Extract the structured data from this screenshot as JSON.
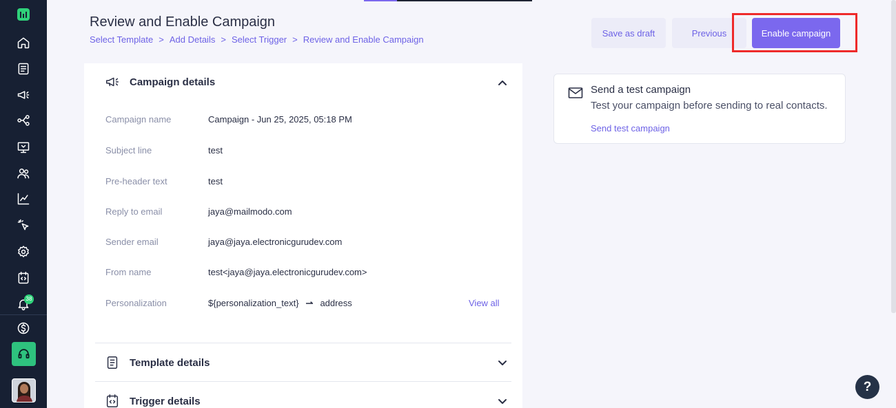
{
  "header": {
    "title": "Review and Enable Campaign",
    "breadcrumb": [
      "Select Template",
      "Add Details",
      "Select Trigger",
      "Review and Enable Campaign"
    ],
    "breadcrumb_separator": ">",
    "buttons": {
      "save_draft": "Save as draft",
      "previous": "Previous",
      "enable": "Enable campaign"
    }
  },
  "sidebar": {
    "icons": [
      "home-icon",
      "list-icon",
      "megaphone-icon",
      "journey-icon",
      "monitor-icon",
      "users-icon",
      "analytics-icon",
      "click-icon",
      "settings-icon",
      "code-icon",
      "bell-icon",
      "dollar-icon",
      "headset-icon"
    ],
    "notification_count": "38"
  },
  "campaign_details": {
    "heading": "Campaign details",
    "rows": [
      {
        "label": "Campaign name",
        "value": "Campaign - Jun 25, 2025, 05:18 PM"
      },
      {
        "label": "Subject line",
        "value": "test"
      },
      {
        "label": "Pre-header text",
        "value": "test"
      },
      {
        "label": "Reply to email",
        "value": "jaya@mailmodo.com"
      },
      {
        "label": "Sender email",
        "value": "jaya@jaya.electronicgurudev.com"
      },
      {
        "label": "From name",
        "value": "test<jaya@jaya.electronicgurudev.com>"
      }
    ],
    "personalization": {
      "label": "Personalization",
      "variable": "${personalization_text}",
      "arrow": "⇀",
      "mapped_to": "address",
      "view_all": "View all"
    }
  },
  "template_details": {
    "heading": "Template details"
  },
  "trigger_details": {
    "heading": "Trigger details"
  },
  "test_campaign": {
    "title": "Send a test campaign",
    "description": "Test your campaign before sending to real contacts.",
    "link": "Send test campaign"
  },
  "help": {
    "label": "?"
  },
  "colors": {
    "accent": "#7b68ee",
    "sidebar_bg": "#172033",
    "highlight": "#ee2a2a",
    "brand_green": "#2fd27a"
  }
}
